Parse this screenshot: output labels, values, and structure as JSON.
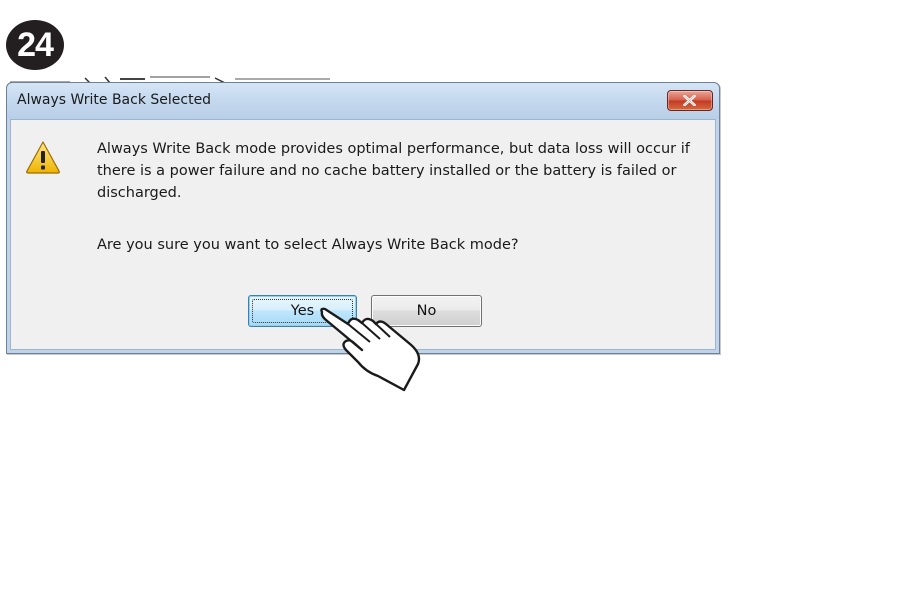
{
  "step": {
    "number": "24"
  },
  "dialog": {
    "title": "Always Write Back Selected",
    "close_icon": "close-x-icon",
    "warning_icon": "warning-triangle-icon",
    "message": "Always Write Back mode provides optimal performance, but data loss will occur if there is a power failure and no cache battery installed or the battery is failed or discharged.",
    "question": "Are you sure you want to select Always Write Back mode?",
    "buttons": {
      "yes_label": "Yes",
      "no_label": "No"
    }
  },
  "pointer": {
    "icon": "hand-pointer-icon"
  },
  "colors": {
    "titlebar": "#c4d8ee",
    "close_button": "#c23a24",
    "content_bg": "#f0f0f0",
    "default_button_border": "#3c7fb1",
    "warning_fill": "#f4c20d",
    "badge_bg": "#231f20"
  }
}
